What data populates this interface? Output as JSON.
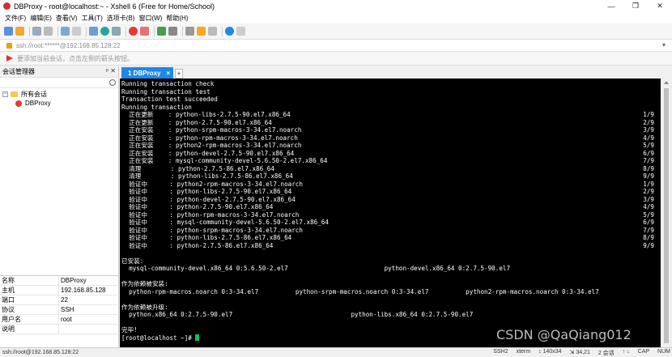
{
  "window": {
    "title": "DBProxy - root@localhost:~ - Xshell 6 (Free for Home/School)",
    "controls": [
      "—",
      "❐",
      "✕"
    ]
  },
  "menu": [
    "文件(F)",
    "编辑(E)",
    "查看(V)",
    "工具(T)",
    "选项卡(B)",
    "窗口(W)",
    "帮助(H)"
  ],
  "address": {
    "text": "ssh://root:******@192.168.85.128:22"
  },
  "hint": {
    "text": "要添加当前会话，点击左侧的箭头按钮。"
  },
  "sidebar": {
    "title": "会话管理器",
    "pin": "ᵖ ✕",
    "tree": [
      {
        "label": "所有会话",
        "type": "folder"
      },
      {
        "label": "DBProxy",
        "type": "session"
      }
    ]
  },
  "properties": [
    {
      "key": "名称",
      "value": "DBProxy"
    },
    {
      "key": "主机",
      "value": "192.168.85.128"
    },
    {
      "key": "端口",
      "value": "22"
    },
    {
      "key": "协议",
      "value": "SSH"
    },
    {
      "key": "用户名",
      "value": "root"
    },
    {
      "key": "说明",
      "value": ""
    }
  ],
  "tab": {
    "label": "1 DBProxy",
    "close": "×",
    "add": "+"
  },
  "terminal": {
    "lines": [
      {
        "left": "Running transaction check",
        "right": ""
      },
      {
        "left": "Running transaction test",
        "right": ""
      },
      {
        "left": "Transaction test succeeded",
        "right": ""
      },
      {
        "left": "Running transaction",
        "right": ""
      },
      {
        "left": "  正在更新    : python-libs-2.7.5-90.el7.x86_64",
        "right": "1/9"
      },
      {
        "left": "  正在更新    : python-2.7.5-90.el7.x86_64",
        "right": "2/9"
      },
      {
        "left": "  正在安装    : python-srpm-macros-3-34.el7.noarch",
        "right": "3/9"
      },
      {
        "left": "  正在安装    : python-rpm-macros-3-34.el7.noarch",
        "right": "4/9"
      },
      {
        "left": "  正在安装    : python2-rpm-macros-3-34.el7.noarch",
        "right": "5/9"
      },
      {
        "left": "  正在安装    : python-devel-2.7.5-90.el7.x86_64",
        "right": "6/9"
      },
      {
        "left": "  正在安装    : mysql-community-devel-5.6.50-2.el7.x86_64",
        "right": "7/9"
      },
      {
        "left": "  清理        : python-2.7.5-86.el7.x86_64",
        "right": "8/9"
      },
      {
        "left": "  清理        : python-libs-2.7.5-86.el7.x86_64",
        "right": "9/9"
      },
      {
        "left": "  验证中      : python2-rpm-macros-3-34.el7.noarch",
        "right": "1/9"
      },
      {
        "left": "  验证中      : python-libs-2.7.5-90.el7.x86_64",
        "right": "2/9"
      },
      {
        "left": "  验证中      : python-devel-2.7.5-90.el7.x86_64",
        "right": "3/9"
      },
      {
        "left": "  验证中      : python-2.7.5-90.el7.x86_64",
        "right": "4/9"
      },
      {
        "left": "  验证中      : python-rpm-macros-3-34.el7.noarch",
        "right": "5/9"
      },
      {
        "left": "  验证中      : mysql-community-devel-5.6.50-2.el7.x86_64",
        "right": "6/9"
      },
      {
        "left": "  验证中      : python-srpm-macros-3-34.el7.noarch",
        "right": "7/9"
      },
      {
        "left": "  验证中      : python-libs-2.7.5-86.el7.x86_64",
        "right": "8/9"
      },
      {
        "left": "  验证中      : python-2.7.5-86.el7.x86_64",
        "right": "9/9"
      },
      {
        "left": "",
        "right": ""
      },
      {
        "left": "已安装:",
        "right": ""
      },
      {
        "left": "  mysql-community-devel.x86_64 0:5.6.50-2.el7                          python-devel.x86_64 0:2.7.5-90.el7",
        "right": ""
      },
      {
        "left": "",
        "right": ""
      },
      {
        "left": "作为依赖被安装:",
        "right": ""
      },
      {
        "left": "  python-rpm-macros.noarch 0:3-34.el7          python-srpm-macros.noarch 0:3-34.el7          python2-rpm-macros.noarch 0:3-34.el7",
        "right": ""
      },
      {
        "left": "",
        "right": ""
      },
      {
        "left": "作为依赖被升级:",
        "right": ""
      },
      {
        "left": "  python.x86_64 0:2.7.5-90.el7                                python-libs.x86_64 0:2.7.5-90.el7",
        "right": ""
      },
      {
        "left": "",
        "right": ""
      },
      {
        "left": "完毕!",
        "right": ""
      }
    ],
    "prompt": "[root@localhost ~]# "
  },
  "status": {
    "left": "ssh://root@192.168.85.128:22",
    "right": [
      "SSH2",
      "xterm",
      "↕ 140x34",
      "⇲ 34,21",
      "2 会话",
      "↑ ↓",
      "CAP",
      "NUM"
    ]
  },
  "watermark": "CSDN @QaQiang012",
  "colors": {
    "tab_accent": "#1e88e5",
    "terminal_bg": "#000000",
    "cursor": "#00c853"
  }
}
